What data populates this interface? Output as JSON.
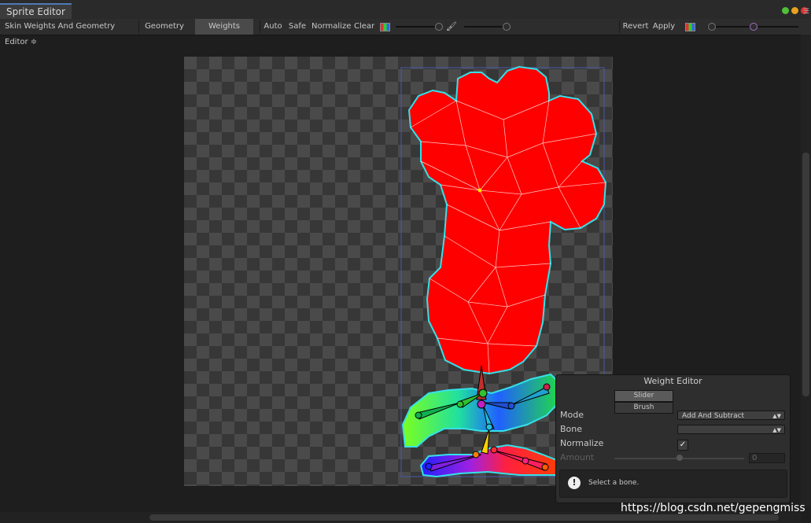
{
  "window": {
    "tab_title": "Sprite Editor"
  },
  "toolbar": {
    "mode_dropdown": "Skin Weights And Geometry Editor ≑",
    "geometry": "Geometry",
    "weights": "Weights",
    "auto": "Auto",
    "safe": "Safe",
    "normalize": "Normalize",
    "clear": "Clear",
    "revert": "Revert",
    "apply": "Apply"
  },
  "weight_editor": {
    "title": "Weight Editor",
    "tabs": [
      "Slider",
      "Brush"
    ],
    "selected_tab": "Slider",
    "mode_label": "Mode",
    "mode_value": "Add And Subtract",
    "bone_label": "Bone",
    "bone_value": "",
    "normalize_label": "Normalize",
    "normalize_checked": true,
    "normalize_mark": "✓",
    "amount_label": "Amount",
    "amount_value": "0",
    "info_icon": "!",
    "info_text": "Select a bone."
  },
  "watermark": "https://blog.csdn.net/gepengmiss",
  "colors": {
    "mesh_fill": "#ff0000",
    "outline": "#35e0e8",
    "accent": "#4d7ab8"
  },
  "icons": [
    "brush-icon",
    "color-swatch-icon",
    "info-icon",
    "menu-icon"
  ]
}
